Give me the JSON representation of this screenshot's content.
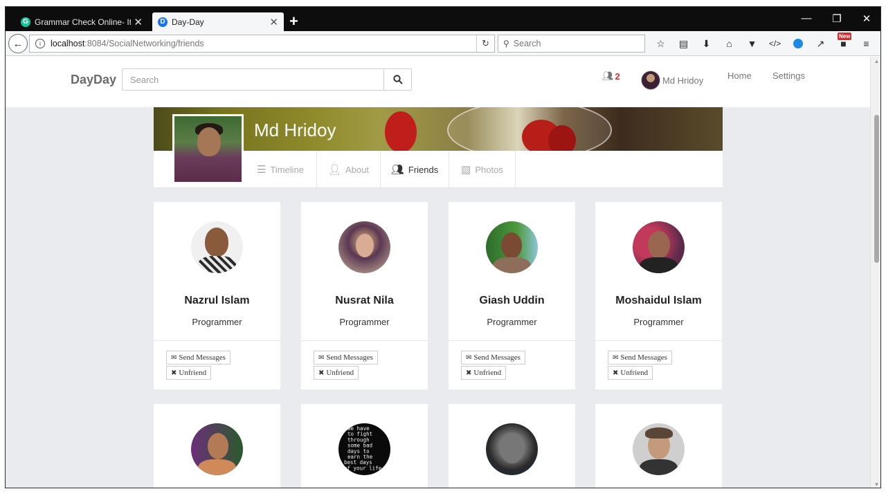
{
  "browser": {
    "tabs": [
      {
        "title": "Grammar Check Online- It's",
        "favicon": "G",
        "favicon_color": "#15c39a",
        "active": false
      },
      {
        "title": "Day-Day",
        "favicon": "D",
        "favicon_color": "#1a73e8",
        "active": true
      }
    ],
    "url": {
      "host": "localhost",
      "path": ":8084/SocialNetworking/friends"
    },
    "search_placeholder": "Search",
    "toolbar_icons": [
      "star-icon",
      "reader-icon",
      "download-icon",
      "home-icon",
      "pocket-icon",
      "dev-icon",
      "messenger-icon",
      "pin-icon",
      "new-badge-icon",
      "menu-icon"
    ],
    "new_badge": "New",
    "window_controls": [
      "minimize-icon",
      "restore-icon",
      "close-icon"
    ]
  },
  "site": {
    "brand": "DayDay",
    "search_placeholder": "Search",
    "friend_requests": "2",
    "user_name": "Md Hridoy",
    "nav": {
      "home": "Home",
      "settings": "Settings"
    }
  },
  "profile": {
    "name": "Md Hridoy",
    "tabs": [
      {
        "label": "Timeline",
        "icon": "list-icon",
        "active": false
      },
      {
        "label": "About",
        "icon": "user-icon",
        "active": false
      },
      {
        "label": "Friends",
        "icon": "users-icon",
        "active": true
      },
      {
        "label": "Photos",
        "icon": "image-icon",
        "active": false
      }
    ]
  },
  "friends": [
    {
      "name": "Nazrul Islam",
      "role": "Programmer",
      "send": "Send Messages",
      "unfriend": "Unfriend"
    },
    {
      "name": "Nusrat Nila",
      "role": "Programmer",
      "send": "Send Messages",
      "unfriend": "Unfriend"
    },
    {
      "name": "Giash Uddin",
      "role": "Programmer",
      "send": "Send Messages",
      "unfriend": "Unfriend"
    },
    {
      "name": "Moshaidul Islam",
      "role": "Programmer",
      "send": "Send Messages",
      "unfriend": "Unfriend"
    }
  ],
  "avatar_quote": [
    "We have",
    "to fight",
    "through",
    "some bad",
    "days to",
    "earn the",
    "best days",
    "of your life"
  ]
}
